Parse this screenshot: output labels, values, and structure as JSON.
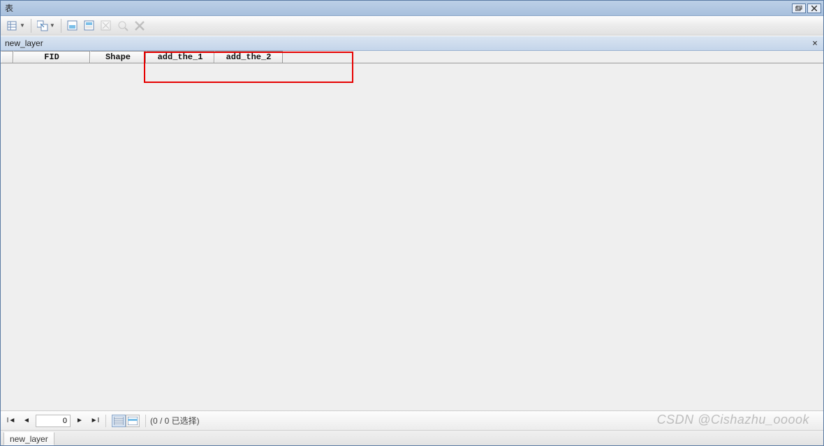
{
  "window": {
    "title": "表"
  },
  "subheader": {
    "layer_name": "new_layer"
  },
  "columns": {
    "c1": "FID",
    "c2": "Shape",
    "c3": "add_the_1",
    "c4": "add_the_2"
  },
  "nav": {
    "current_record": "0",
    "selection_text": "(0 / 0 已选择)"
  },
  "tab": {
    "label": "new_layer"
  },
  "watermark": "CSDN @Cishazhu_ooook"
}
